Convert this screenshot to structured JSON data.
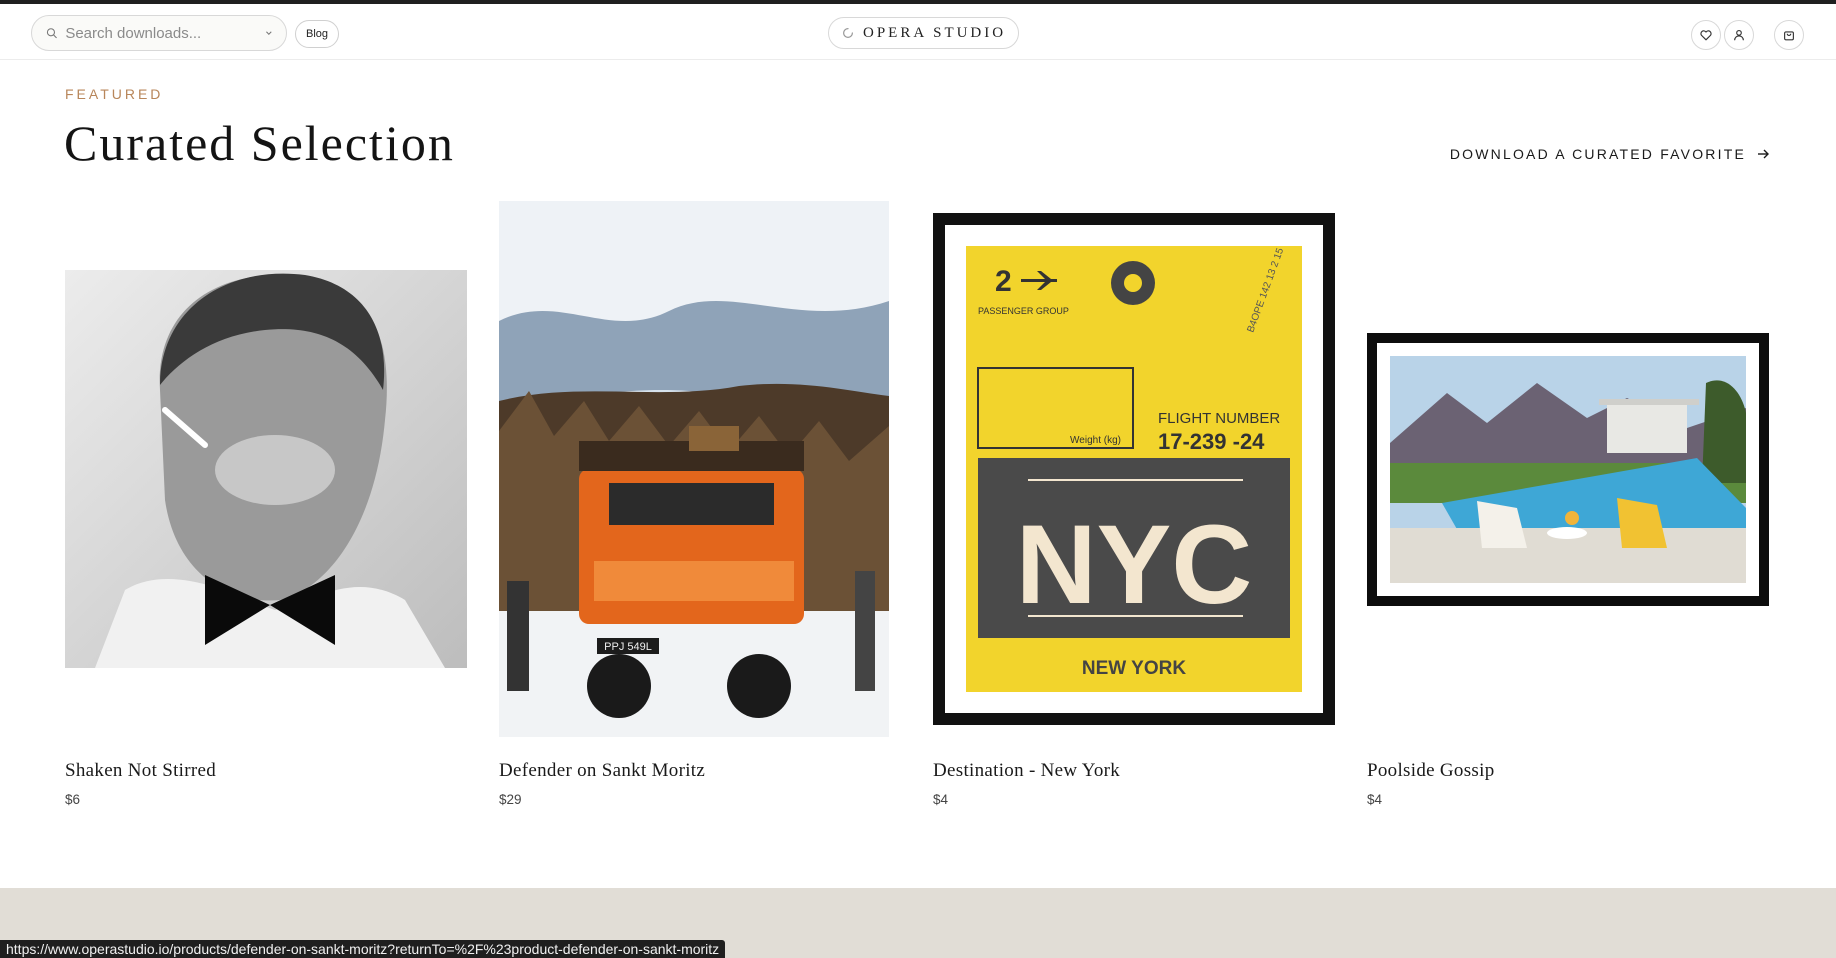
{
  "header": {
    "search": {
      "placeholder": "Search downloads..."
    },
    "blog_label": "Blog",
    "logo_text": "OPERA STUDIO"
  },
  "section": {
    "eyebrow": "FEATURED",
    "title": "Curated Selection",
    "cta_label": "DOWNLOAD A CURATED FAVORITE"
  },
  "products": [
    {
      "title": "Shaken Not Stirred",
      "price": "$6"
    },
    {
      "title": "Defender on Sankt Moritz",
      "price": "$29"
    },
    {
      "title": "Destination - New York",
      "price": "$4"
    },
    {
      "title": "Poolside Gossip",
      "price": "$4"
    }
  ],
  "artwork": {
    "plate": "PPJ 549L",
    "tag_number": "2",
    "passenger_group": "PASSENGER GROUP",
    "weight_label": "Weight (kg)",
    "flight_number_label": "FLIGHT NUMBER",
    "flight_number": "17-239 -24",
    "city_code": "NYC",
    "city_name": "NEW YORK",
    "stamp_text": "B4OPE 142 13 2 15"
  },
  "status_bar": {
    "url": "https://www.operastudio.io/products/defender-on-sankt-moritz?returnTo=%2F%23product-defender-on-sankt-moritz"
  },
  "icons": [
    "search-icon",
    "chevron-down-icon",
    "logo-mark-icon",
    "heart-icon",
    "user-icon",
    "cart-icon",
    "arrow-right-icon",
    "airplane-icon"
  ],
  "colors": {
    "accent": "#b8865a",
    "footer_band": "#e1ddd6",
    "tag_yellow": "#f2d42c"
  }
}
